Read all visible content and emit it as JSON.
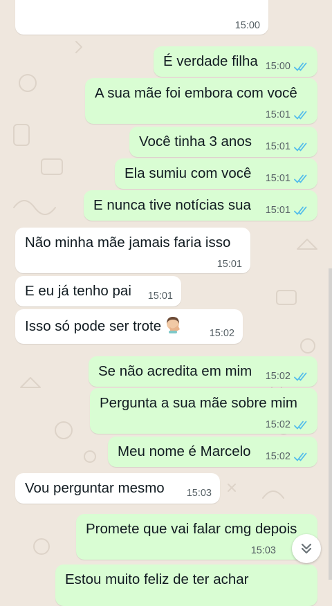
{
  "chat": {
    "messages": [
      {
        "dir": "in",
        "text": "",
        "time": "15:00",
        "read": false
      },
      {
        "dir": "out",
        "text": "É verdade filha",
        "time": "15:00",
        "read": true
      },
      {
        "dir": "out",
        "text": "A sua mãe foi embora com você",
        "time": "15:01",
        "read": true
      },
      {
        "dir": "out",
        "text": "Você tinha 3 anos",
        "time": "15:01",
        "read": true
      },
      {
        "dir": "out",
        "text": "Ela sumiu com você",
        "time": "15:01",
        "read": true
      },
      {
        "dir": "out",
        "text": "E nunca tive notícias sua",
        "time": "15:01",
        "read": true
      },
      {
        "dir": "in",
        "text": "Não minha mãe jamais faria isso",
        "time": "15:01",
        "read": false
      },
      {
        "dir": "in",
        "text": "E eu já tenho pai",
        "time": "15:01",
        "read": false
      },
      {
        "dir": "in",
        "text": "Isso só pode ser trote",
        "emoji": "woman-facepalming-emoji",
        "time": "15:02",
        "read": false
      },
      {
        "dir": "out",
        "text": "Se não acredita em mim",
        "time": "15:02",
        "read": true
      },
      {
        "dir": "out",
        "text": "Pergunta a sua mãe sobre mim",
        "time": "15:02",
        "read": true
      },
      {
        "dir": "out",
        "text": "Meu nome é Marcelo",
        "time": "15:02",
        "read": true
      },
      {
        "dir": "in",
        "text": "Vou perguntar mesmo",
        "time": "15:03",
        "read": false
      },
      {
        "dir": "out",
        "text": "Promete que vai falar cmg depois",
        "time": "15:03",
        "read": true
      },
      {
        "dir": "out",
        "text": "Estou muito feliz de ter achar",
        "time": "",
        "read": false
      }
    ]
  },
  "colors": {
    "outgoing_bubble": "#d9fdd3",
    "incoming_bubble": "#ffffff",
    "read_ticks": "#53bdeb",
    "background": "#efe7de"
  },
  "icons": {
    "read_receipt": "double-check-icon",
    "scroll_down": "double-chevron-down-icon"
  }
}
